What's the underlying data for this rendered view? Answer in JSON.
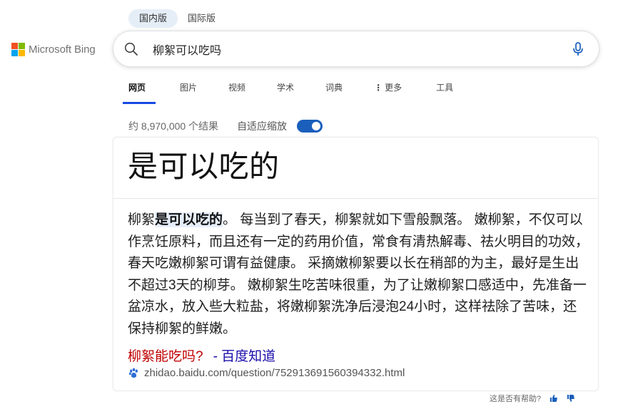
{
  "region_tabs": [
    {
      "label": "国内版",
      "active": true
    },
    {
      "label": "国际版",
      "active": false
    }
  ],
  "logo": {
    "text": "Microsoft Bing"
  },
  "search": {
    "query": "柳絮可以吃吗"
  },
  "scopes": [
    {
      "label": "网页",
      "active": true
    },
    {
      "label": "图片"
    },
    {
      "label": "视频"
    },
    {
      "label": "学术"
    },
    {
      "label": "词典"
    },
    {
      "label": "更多",
      "has_dots": true
    },
    {
      "label": "工具"
    }
  ],
  "results": {
    "count_text": "约 8,970,000 个结果",
    "adaptive_label": "自适应缩放",
    "adaptive_on": true
  },
  "answer": {
    "headline": "是可以吃的",
    "body_prefix": "柳絮",
    "body_highlight": "是可以吃的",
    "body_rest": "。 每当到了春天，柳絮就如下雪般飘落。 嫩柳絮，不仅可以作烹饪原料，而且还有一定的药用价值，常食有清热解毒、祛火明目的功效，春天吃嫩柳絮可谓有益健康。 采摘嫩柳絮要以长在稍部的为主，最好是生出不超过3天的柳芽。 嫩柳絮生吃苦味很重，为了让嫩柳絮口感适中，先准备一盆凉水，放入些大粒盐，将嫩柳絮洗净后浸泡24小时，这样祛除了苦味，还保持柳絮的鲜嫩。",
    "source_title": "柳絮能吃吗?",
    "source_site": "- 百度知道",
    "source_url": "zhidao.baidu.com/question/752913691560394332.html"
  },
  "feedback": {
    "label": "这是否有帮助?"
  },
  "colors": {
    "accent": "#174ae4",
    "source_title": "#c00000",
    "link": "#1a0dab",
    "toggle": "#1a5fbb"
  }
}
